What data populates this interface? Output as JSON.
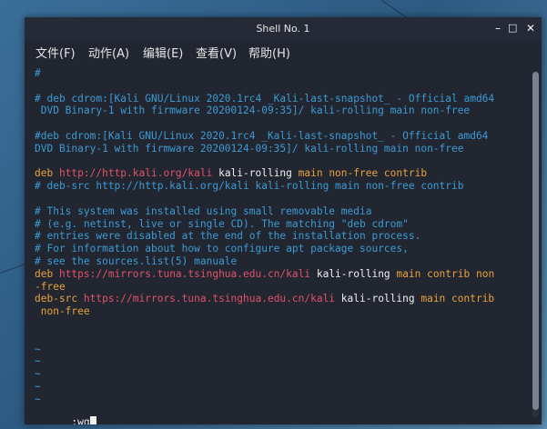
{
  "window": {
    "title": "Shell No. 1",
    "min": "–",
    "max": "□",
    "close": "✕"
  },
  "menu": [
    "文件(F)",
    "动作(A)",
    "编辑(E)",
    "查看(V)",
    "帮助(H)"
  ],
  "lines": [
    [
      {
        "t": "#",
        "c": "comment"
      }
    ],
    [],
    [
      {
        "t": "# deb cdrom:[Kali GNU/Linux 2020.1rc4 _Kali-last-snapshot_ - Official amd64",
        "c": "comment"
      }
    ],
    [
      {
        "t": " DVD Binary-1 with firmware 20200124-09:35]/ kali-rolling main non-free",
        "c": "comment"
      }
    ],
    [],
    [
      {
        "t": "#deb cdrom:[Kali GNU/Linux 2020.1rc4 _Kali-last-snapshot_ - Official amd64",
        "c": "comment"
      }
    ],
    [
      {
        "t": "DVD Binary-1 with firmware 20200124-09:35]/ kali-rolling main non-free",
        "c": "comment"
      }
    ],
    [],
    [
      {
        "t": "deb ",
        "c": "kw"
      },
      {
        "t": "http://http.kali.org/kali",
        "c": "url"
      },
      {
        "t": " kali-rolling ",
        "c": "white"
      },
      {
        "t": "main non-free contrib",
        "c": "kw"
      }
    ],
    [
      {
        "t": "# deb-src http://http.kali.org/kali kali-rolling main non-free contrib",
        "c": "comment"
      }
    ],
    [],
    [
      {
        "t": "# This system was installed using small removable media",
        "c": "comment"
      }
    ],
    [
      {
        "t": "# (e.g. netinst, live or single CD). The matching \"deb cdrom\"",
        "c": "comment"
      }
    ],
    [
      {
        "t": "# entries were disabled at the end of the installation process.",
        "c": "comment"
      }
    ],
    [
      {
        "t": "# For information about how to configure apt package sources,",
        "c": "comment"
      }
    ],
    [
      {
        "t": "# see the sources.list(5) manuale",
        "c": "comment"
      }
    ],
    [
      {
        "t": "deb ",
        "c": "kw"
      },
      {
        "t": "https://mirrors.tuna.tsinghua.edu.cn/kali",
        "c": "url"
      },
      {
        "t": " kali-rolling ",
        "c": "white"
      },
      {
        "t": "main contrib non",
        "c": "kw"
      }
    ],
    [
      {
        "t": "-free",
        "c": "kw"
      }
    ],
    [
      {
        "t": "deb-src ",
        "c": "kw"
      },
      {
        "t": "https://mirrors.tuna.tsinghua.edu.cn/kali",
        "c": "url"
      },
      {
        "t": " kali-rolling ",
        "c": "white"
      },
      {
        "t": "main contrib",
        "c": "kw"
      }
    ],
    [
      {
        "t": " non-free",
        "c": "kw"
      }
    ],
    [],
    [],
    [
      {
        "t": "~",
        "c": "tilde"
      }
    ],
    [
      {
        "t": "~",
        "c": "tilde"
      }
    ],
    [
      {
        "t": "~",
        "c": "tilde"
      }
    ],
    [
      {
        "t": "~",
        "c": "tilde"
      }
    ],
    [
      {
        "t": "~",
        "c": "tilde"
      }
    ]
  ],
  "command": ":wq",
  "colors": {
    "comment": "#3d9bd3",
    "keyword": "#e7a23b",
    "url": "#e0526a",
    "text": "#f0f0f0",
    "background": "#212631"
  }
}
